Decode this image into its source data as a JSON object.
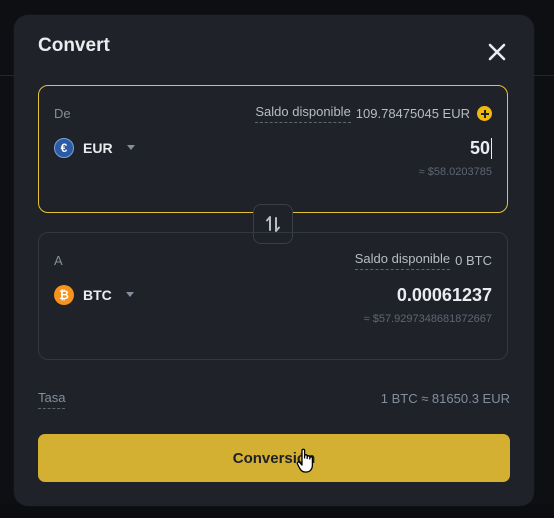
{
  "modal": {
    "title": "Convert",
    "close_icon": "close-icon"
  },
  "from": {
    "label": "De",
    "balance_label": "Saldo disponible",
    "balance_value": "109.78475045 EUR",
    "currency": "EUR",
    "amount": "50",
    "approx": "≈ $58.0203785",
    "coin_symbol": "€"
  },
  "to": {
    "label": "A",
    "balance_label": "Saldo disponible",
    "balance_value": "0 BTC",
    "currency": "BTC",
    "amount": "0.00061237",
    "approx": "≈ $57.9297348681872667",
    "coin_symbol": "₿"
  },
  "rate": {
    "label": "Tasa",
    "value": "1 BTC ≈ 81650.3 EUR"
  },
  "button": {
    "label": "Conversión"
  },
  "colors": {
    "accent": "#f0b90b",
    "button": "#d4b032",
    "active_border": "#e6c13a",
    "panel_bg": "#1f2228"
  }
}
